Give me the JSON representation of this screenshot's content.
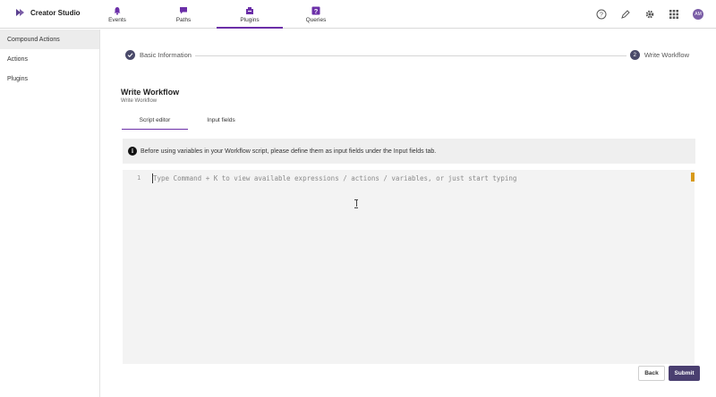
{
  "app": {
    "title": "Creator Studio",
    "logo_icon": "double-play-icon",
    "brand_color": "#6b2fa8"
  },
  "nav": {
    "tabs": [
      {
        "label": "Events",
        "icon": "bell-icon"
      },
      {
        "label": "Paths",
        "icon": "chat-flag-icon"
      },
      {
        "label": "Plugins",
        "icon": "plugin-box-icon",
        "active": true
      },
      {
        "label": "Queries",
        "icon": "question-box-icon"
      }
    ],
    "right_icons": [
      "help-icon",
      "pen-icon",
      "gear-icon",
      "app-grid-icon"
    ],
    "avatar_initials": "AM"
  },
  "sidebar": {
    "items": [
      {
        "label": "Compound Actions",
        "active": true
      },
      {
        "label": "Actions"
      },
      {
        "label": "Plugins"
      }
    ]
  },
  "stepper": {
    "steps": [
      {
        "label": "Basic Information",
        "state": "done"
      },
      {
        "number": "2",
        "label": "Write Workflow",
        "state": "current"
      }
    ]
  },
  "section": {
    "title": "Write Workflow",
    "subtitle": "Write Workflow"
  },
  "tabs": [
    {
      "label": "Script editor",
      "active": true
    },
    {
      "label": "Input fields"
    }
  ],
  "banner": {
    "text": "Before using variables in your Workflow script, please define them as input fields under the Input fields tab."
  },
  "editor": {
    "line_number": "1",
    "value": "",
    "placeholder": "Type Command + K to view available expressions / actions / variables, or just start typing"
  },
  "footer": {
    "back_label": "Back",
    "submit_label": "Submit"
  },
  "colors": {
    "accent": "#6b2fa8",
    "submit_bg": "#4a3f70",
    "step_circle": "#4a4a6a",
    "scroll_marker": "#d89a1a"
  }
}
